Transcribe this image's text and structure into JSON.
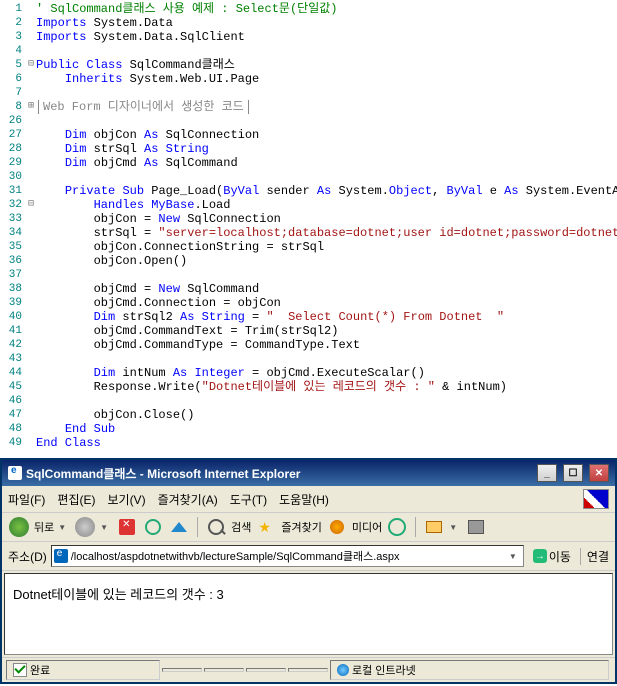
{
  "code": {
    "lines": [
      {
        "n": "1",
        "fold": "",
        "html": "<span class='c-comment'>' SqlCommand클래스 사용 예제 : Select문(단일값)</span>"
      },
      {
        "n": "2",
        "fold": "",
        "html": "<span class='c-keyword'>Imports</span><span class='c-text'> System.Data</span>"
      },
      {
        "n": "3",
        "fold": "",
        "html": "<span class='c-keyword'>Imports</span><span class='c-text'> System.Data.SqlClient</span>"
      },
      {
        "n": "4",
        "fold": "",
        "html": ""
      },
      {
        "n": "5",
        "fold": "⊟",
        "html": "<span class='c-keyword'>Public</span><span class='c-text'> </span><span class='c-keyword'>Class</span><span class='c-text'> SqlCommand클래스</span>"
      },
      {
        "n": "6",
        "fold": "",
        "html": "<span class='c-text'>    </span><span class='c-keyword'>Inherits</span><span class='c-text'> System.Web.UI.Page</span>"
      },
      {
        "n": "7",
        "fold": "",
        "html": ""
      },
      {
        "n": "8",
        "fold": "⊞",
        "html": "<span class='boxed'>Web Form 디자이너에서 생성한 코드</span>"
      },
      {
        "n": "26",
        "fold": "",
        "html": ""
      },
      {
        "n": "27",
        "fold": "",
        "html": "<span class='c-text'>    </span><span class='c-keyword'>Dim</span><span class='c-text'> objCon </span><span class='c-keyword'>As</span><span class='c-text'> SqlConnection</span>"
      },
      {
        "n": "28",
        "fold": "",
        "html": "<span class='c-text'>    </span><span class='c-keyword'>Dim</span><span class='c-text'> strSql </span><span class='c-keyword'>As</span><span class='c-text'> </span><span class='c-keyword'>String</span>"
      },
      {
        "n": "29",
        "fold": "",
        "html": "<span class='c-text'>    </span><span class='c-keyword'>Dim</span><span class='c-text'> objCmd </span><span class='c-keyword'>As</span><span class='c-text'> SqlCommand</span>"
      },
      {
        "n": "30",
        "fold": "",
        "html": ""
      },
      {
        "n": "31",
        "fold": "",
        "html": "<span class='c-text'>    </span><span class='c-keyword'>Private</span><span class='c-text'> </span><span class='c-keyword'>Sub</span><span class='c-text'> Page_Load(</span><span class='c-keyword'>ByVal</span><span class='c-text'> sender </span><span class='c-keyword'>As</span><span class='c-text'> System.</span><span class='c-keyword'>Object</span><span class='c-text'>, </span><span class='c-keyword'>ByVal</span><span class='c-text'> e </span><span class='c-keyword'>As</span><span class='c-text'> System.EventArgs) _</span>"
      },
      {
        "n": "32",
        "fold": "⊟",
        "html": "<span class='c-text'>        </span><span class='c-keyword'>Handles</span><span class='c-text'> </span><span class='c-keyword'>MyBase</span><span class='c-text'>.Load</span>"
      },
      {
        "n": "33",
        "fold": "",
        "html": "<span class='c-text'>        objCon = </span><span class='c-keyword'>New</span><span class='c-text'> SqlConnection</span>"
      },
      {
        "n": "34",
        "fold": "",
        "html": "<span class='c-text'>        strSql = </span><span class='c-string'>\"server=localhost;database=dotnet;user id=dotnet;password=dotnet\"</span>"
      },
      {
        "n": "35",
        "fold": "",
        "html": "<span class='c-text'>        objCon.ConnectionString = strSql</span>"
      },
      {
        "n": "36",
        "fold": "",
        "html": "<span class='c-text'>        objCon.Open()</span>"
      },
      {
        "n": "37",
        "fold": "",
        "html": ""
      },
      {
        "n": "38",
        "fold": "",
        "html": "<span class='c-text'>        objCmd = </span><span class='c-keyword'>New</span><span class='c-text'> SqlCommand</span>"
      },
      {
        "n": "39",
        "fold": "",
        "html": "<span class='c-text'>        objCmd.Connection = objCon</span>"
      },
      {
        "n": "40",
        "fold": "",
        "html": "<span class='c-text'>        </span><span class='c-keyword'>Dim</span><span class='c-text'> strSql2 </span><span class='c-keyword'>As</span><span class='c-text'> </span><span class='c-keyword'>String</span><span class='c-text'> = </span><span class='c-string'>\"  Select Count(*) From Dotnet  \"</span>"
      },
      {
        "n": "41",
        "fold": "",
        "html": "<span class='c-text'>        objCmd.CommandText = Trim(strSql2)</span>"
      },
      {
        "n": "42",
        "fold": "",
        "html": "<span class='c-text'>        objCmd.CommandType = CommandType.Text</span>"
      },
      {
        "n": "43",
        "fold": "",
        "html": ""
      },
      {
        "n": "44",
        "fold": "",
        "html": "<span class='c-text'>        </span><span class='c-keyword'>Dim</span><span class='c-text'> intNum </span><span class='c-keyword'>As</span><span class='c-text'> </span><span class='c-keyword'>Integer</span><span class='c-text'> = objCmd.ExecuteScalar()</span>"
      },
      {
        "n": "45",
        "fold": "",
        "html": "<span class='c-text'>        Response.Write(</span><span class='c-string'>\"Dotnet테이블에 있는 레코드의 갯수 : \"</span><span class='c-text'> &amp; intNum)</span>"
      },
      {
        "n": "46",
        "fold": "",
        "html": ""
      },
      {
        "n": "47",
        "fold": "",
        "html": "<span class='c-text'>        objCon.Close()</span>"
      },
      {
        "n": "48",
        "fold": "",
        "html": "<span class='c-text'>    </span><span class='c-keyword'>End Sub</span>"
      },
      {
        "n": "49",
        "fold": "",
        "html": "<span class='c-keyword'>End Class</span>"
      }
    ]
  },
  "ie": {
    "title": "SqlCommand클래스 - Microsoft Internet Explorer",
    "menu": [
      "파일(F)",
      "편집(E)",
      "보기(V)",
      "즐겨찾기(A)",
      "도구(T)",
      "도움말(H)"
    ],
    "toolbar": {
      "back": "뒤로",
      "search": "검색",
      "fav": "즐겨찾기",
      "media": "미디어"
    },
    "address_label": "주소(D)",
    "url": "/localhost/aspdotnetwithvb/lectureSample/SqlCommand클래스.aspx",
    "go": "이동",
    "links": "연결",
    "content": "Dotnet테이블에 있는 레코드의 갯수 : 3",
    "status_done": "완료",
    "status_zone": "로컬 인트라넷"
  }
}
